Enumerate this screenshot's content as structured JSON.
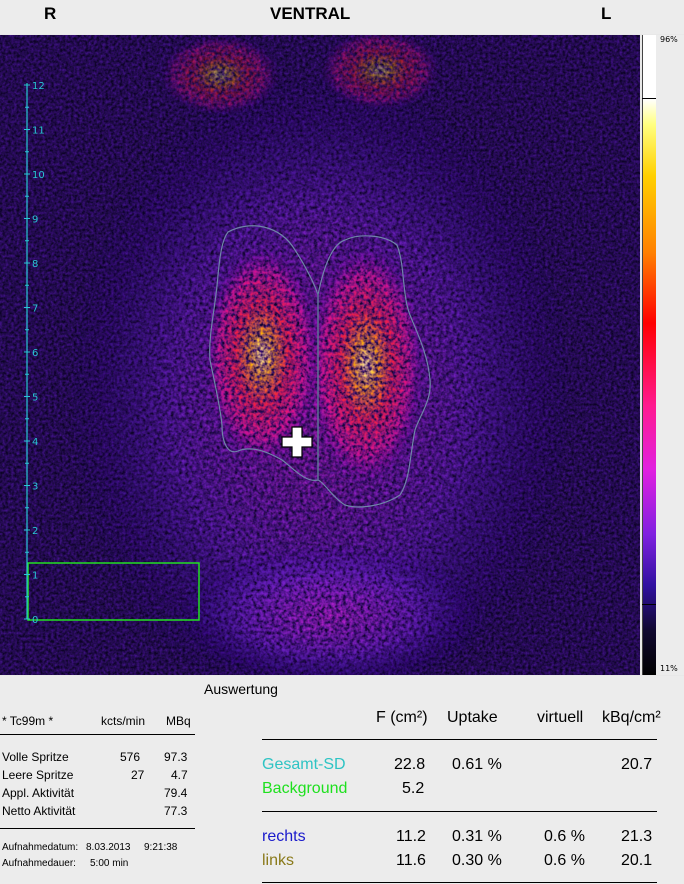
{
  "header": {
    "left": "R",
    "title": "VENTRAL",
    "right": "L"
  },
  "colorbar": {
    "top_label": "96%",
    "bottom_label": "11%"
  },
  "scale": {
    "ticks": [
      "0",
      "1",
      "2",
      "3",
      "4",
      "5",
      "6",
      "7",
      "8",
      "9",
      "10",
      "11",
      "12"
    ]
  },
  "auswertung_title": "Auswertung",
  "left_table": {
    "isotope": "* Tc99m *",
    "col1": "kcts/min",
    "col2": "MBq",
    "rows": [
      {
        "label": "Volle Spritze",
        "kcts": "576",
        "mbq": "97.3"
      },
      {
        "label": "Leere Spritze",
        "kcts": "27",
        "mbq": "4.7"
      },
      {
        "label": "Appl. Aktivität",
        "kcts": "",
        "mbq": "79.4"
      },
      {
        "label": "Netto Aktivität",
        "kcts": "",
        "mbq": "77.3"
      }
    ],
    "date_label": "Aufnahmedatum:",
    "date_value": "8.03.2013",
    "time_value": "9:21:38",
    "duration_label": "Aufnahmedauer:",
    "duration_value": "5:00 min"
  },
  "right_table": {
    "headers": [
      "F (cm²)",
      "Uptake",
      "virtuell",
      "kBq/cm²"
    ],
    "rows": [
      {
        "label": "Gesamt-SD",
        "color": "#2ec4c4",
        "f": "22.8",
        "uptake": "0.61 %",
        "virtuell": "",
        "kbq": "20.7"
      },
      {
        "label": "Background",
        "color": "#1ee01e",
        "f": "5.2",
        "uptake": "",
        "virtuell": "",
        "kbq": ""
      },
      {
        "label": "rechts",
        "color": "#1a1acc",
        "f": "11.2",
        "uptake": "0.31 %",
        "virtuell": "0.6 %",
        "kbq": "21.3"
      },
      {
        "label": "links",
        "color": "#8a7a1a",
        "f": "11.6",
        "uptake": "0.30 %",
        "virtuell": "0.6 %",
        "kbq": "20.1"
      }
    ]
  },
  "colors": {
    "roi": "#7a8aa8",
    "background_roi": "#22e022",
    "scale": "#29c6d6"
  }
}
